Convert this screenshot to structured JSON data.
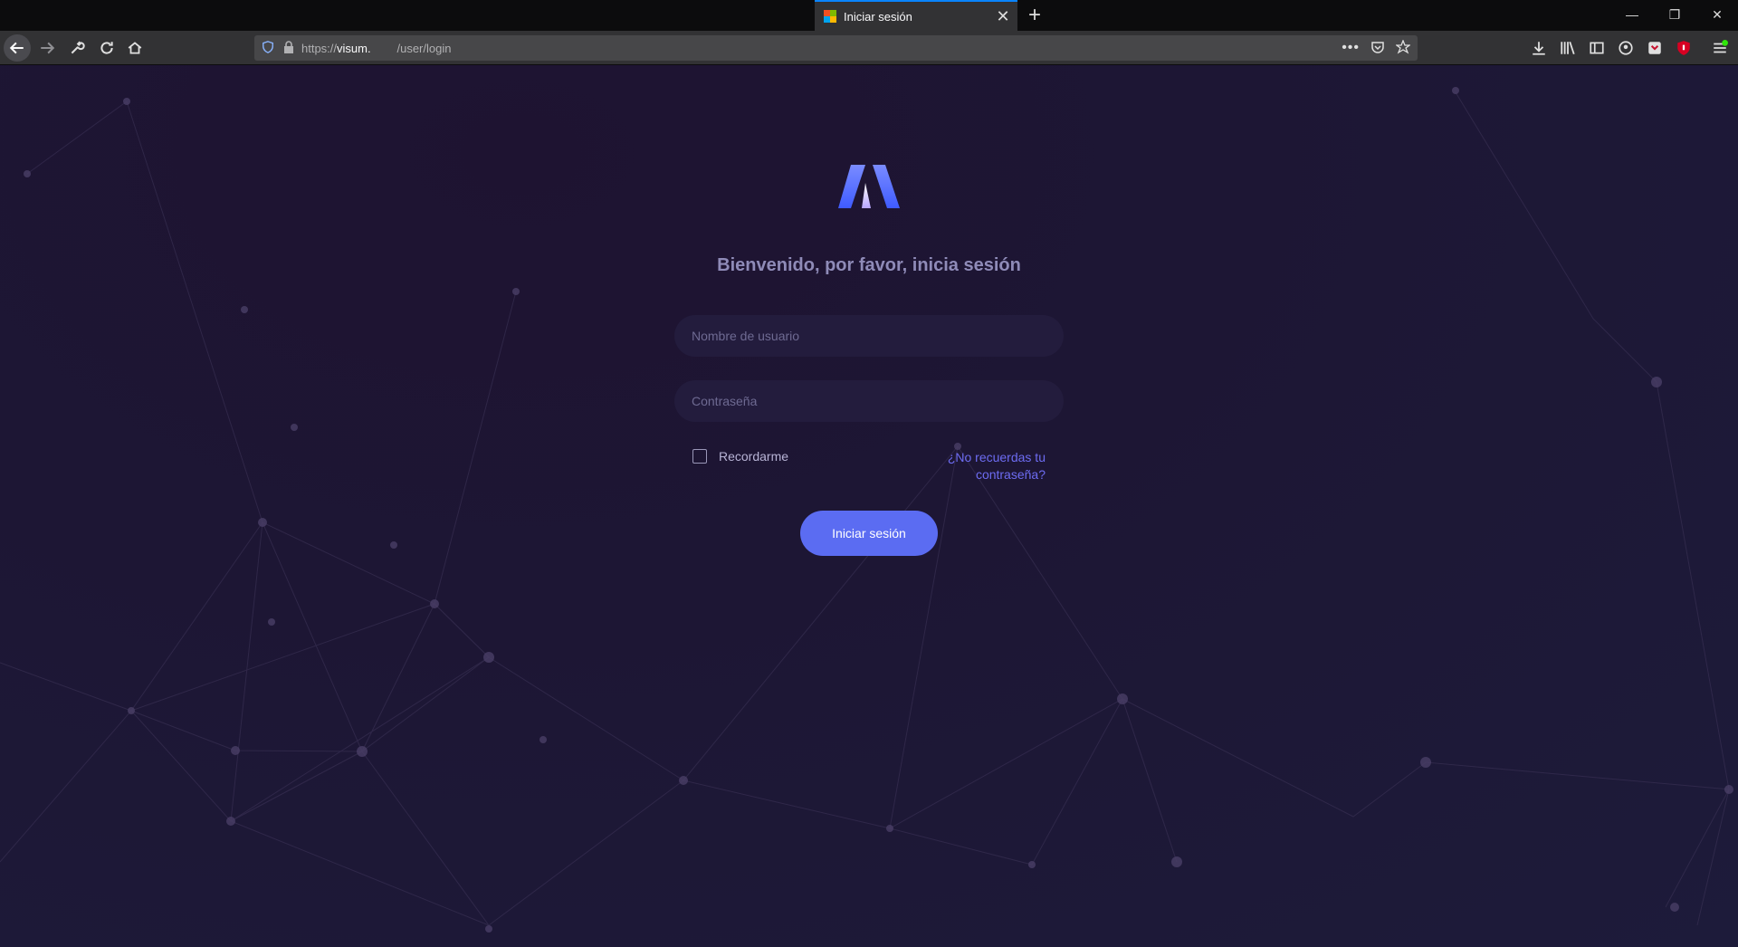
{
  "browser": {
    "tab": {
      "title": "Iniciar sesión"
    },
    "url": {
      "scheme": "https://",
      "host": "visum.",
      "path": "        /user/login"
    }
  },
  "login": {
    "welcome": "Bienvenido, por favor, inicia sesión",
    "username_placeholder": "Nombre de usuario",
    "password_placeholder": "Contraseña",
    "remember_label": "Recordarme",
    "forgot_label": "¿No recuerdas tu contraseña?",
    "submit_label": "Iniciar sesión"
  },
  "colors": {
    "page_bg": "#1c1430",
    "accent": "#5b6cf2",
    "link": "#6d6cf2",
    "tab_highlight": "#0a84ff"
  }
}
